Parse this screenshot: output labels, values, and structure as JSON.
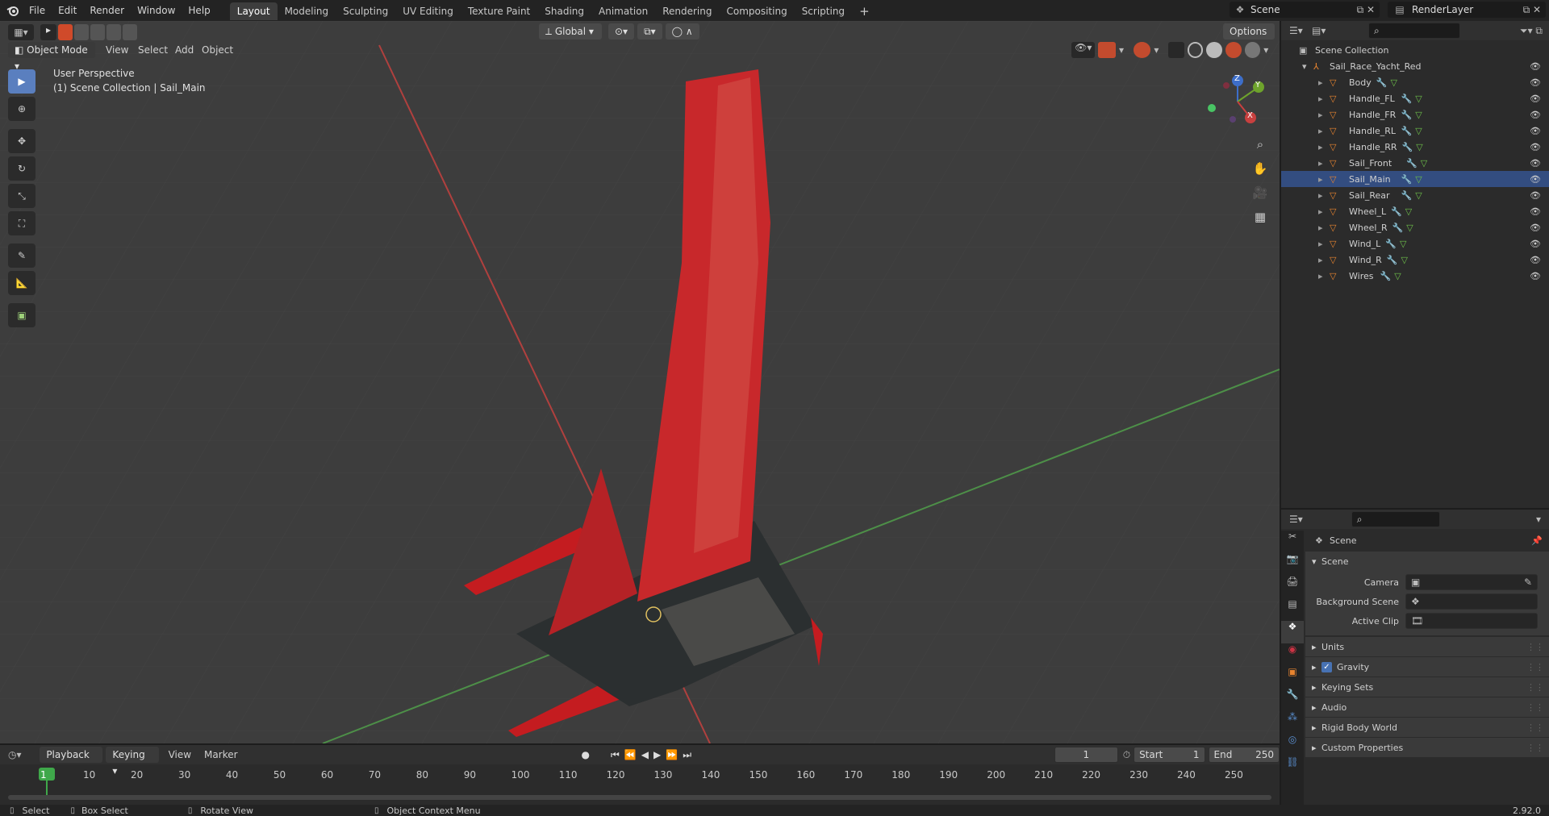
{
  "topbar": {
    "menus": [
      "File",
      "Edit",
      "Render",
      "Window",
      "Help"
    ],
    "workspaces": [
      "Layout",
      "Modeling",
      "Sculpting",
      "UV Editing",
      "Texture Paint",
      "Shading",
      "Animation",
      "Rendering",
      "Compositing",
      "Scripting"
    ],
    "active_workspace": "Layout",
    "scene_name": "Scene",
    "render_layer": "RenderLayer"
  },
  "viewport": {
    "mode": "Object Mode",
    "menus": [
      "View",
      "Select",
      "Add",
      "Object"
    ],
    "transform_orientation": "Global",
    "options_label": "Options",
    "overlay_line1": "User Perspective",
    "overlay_line2": "(1) Scene Collection | Sail_Main",
    "gizmo_axes": [
      "Z",
      "Y",
      "X"
    ]
  },
  "outliner": {
    "root": "Scene Collection",
    "collection": "Sail_Race_Yacht_Red",
    "objects": [
      "Body",
      "Handle_FL",
      "Handle_FR",
      "Handle_RL",
      "Handle_RR",
      "Sail_Front",
      "Sail_Main",
      "Sail_Rear",
      "Wheel_L",
      "Wheel_R",
      "Wind_L",
      "Wind_R",
      "Wires"
    ],
    "selected": "Sail_Main"
  },
  "properties": {
    "context_title": "Scene",
    "panel_title": "Scene",
    "fields": [
      {
        "label": "Camera",
        "value": ""
      },
      {
        "label": "Background Scene",
        "value": ""
      },
      {
        "label": "Active Clip",
        "value": ""
      }
    ],
    "subpanels": [
      "Units",
      "Gravity",
      "Keying Sets",
      "Audio",
      "Rigid Body World",
      "Custom Properties"
    ],
    "gravity_checked": true
  },
  "timeline": {
    "menus": [
      "Playback",
      "Keying",
      "View",
      "Marker"
    ],
    "current_frame": "1",
    "start_label": "Start",
    "start_value": "1",
    "end_label": "End",
    "end_value": "250",
    "ticks": [
      "1",
      "10",
      "20",
      "30",
      "40",
      "50",
      "60",
      "70",
      "80",
      "90",
      "100",
      "110",
      "120",
      "130",
      "140",
      "150",
      "160",
      "170",
      "180",
      "190",
      "200",
      "210",
      "220",
      "230",
      "240",
      "250"
    ]
  },
  "statusbar": {
    "select": "Select",
    "box_select": "Box Select",
    "rotate_view": "Rotate View",
    "context_menu": "Object Context Menu",
    "version": "2.92.0"
  },
  "colors": {
    "accent": "#5a7fbf",
    "x_axis": "#c8403f",
    "y_axis": "#55a14c",
    "object_orange": "#e8842f"
  }
}
